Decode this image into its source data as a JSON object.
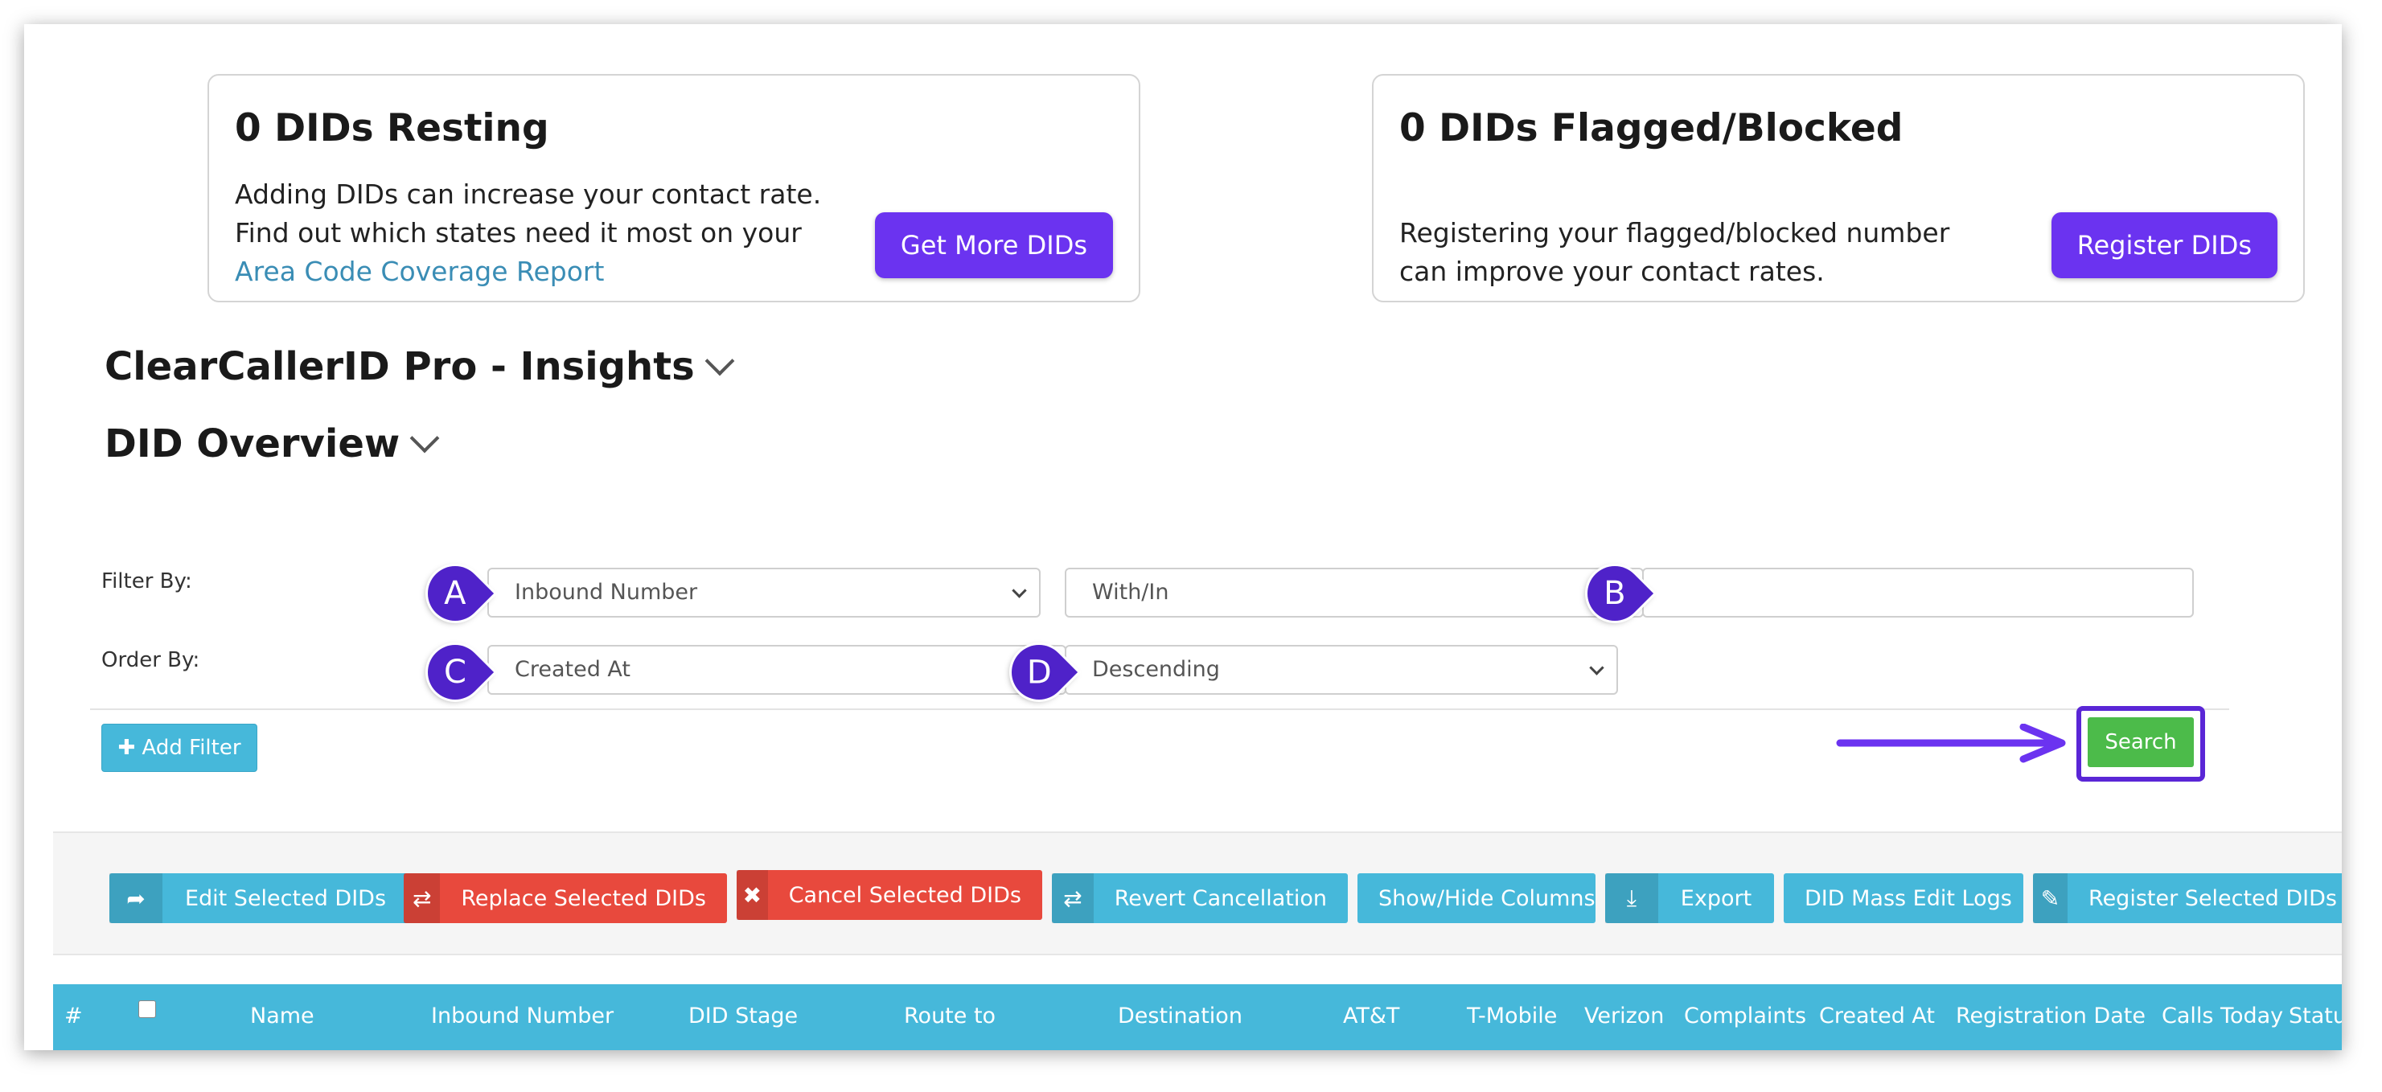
{
  "cards": {
    "resting": {
      "title": "0 DIDs Resting",
      "line1": "Adding DIDs can increase your contact rate.",
      "line2": "Find out which states need it most on your",
      "link": "Area Code Coverage Report",
      "button": "Get More DIDs"
    },
    "flagged": {
      "title": "0 DIDs Flagged/Blocked",
      "line1": "Registering your flagged/blocked number",
      "line2": "can improve your contact rates.",
      "button": "Register DIDs"
    }
  },
  "sections": {
    "insights": "ClearCallerID Pro - Insights",
    "overview": "DID Overview"
  },
  "filters": {
    "filter_label": "Filter By:",
    "order_label": "Order By:",
    "filter_field": "Inbound Number",
    "filter_operator": "With/In",
    "filter_value": "",
    "order_field": "Created At",
    "order_direction": "Descending",
    "add_filter": "Add Filter",
    "search": "Search"
  },
  "markers": [
    "A",
    "B",
    "C",
    "D"
  ],
  "toolbar": [
    {
      "label": "Edit Selected DIDs",
      "icon": "share-arrow-icon",
      "glyph": "➦",
      "color": "#46b8da"
    },
    {
      "label": "Replace Selected DIDs",
      "icon": "retweet-icon",
      "glyph": "⇄",
      "color": "#e8493d"
    },
    {
      "label": "Cancel Selected DIDs",
      "icon": "close-icon",
      "glyph": "✖",
      "color": "#e8493d"
    },
    {
      "label": "Revert Cancellation",
      "icon": "retweet-icon",
      "glyph": "⇄",
      "color": "#46b8da"
    },
    {
      "label": "Show/Hide Columns",
      "icon": "",
      "glyph": "",
      "color": "#46b8da"
    },
    {
      "label": "Export",
      "icon": "download-icon",
      "glyph": "⤓",
      "color": "#46b8da"
    },
    {
      "label": "DID Mass Edit Logs",
      "icon": "",
      "glyph": "",
      "color": "#46b8da"
    },
    {
      "label": "Register Selected DIDs",
      "icon": "edit-icon",
      "glyph": "✎",
      "color": "#46b8da"
    }
  ],
  "table": {
    "columns": [
      "#",
      "Name",
      "Inbound Number",
      "DID Stage",
      "Route to",
      "Destination",
      "AT&T",
      "T-Mobile",
      "Verizon",
      "Complaints",
      "Created At",
      "Registration Date",
      "Calls Today",
      "Status"
    ]
  }
}
